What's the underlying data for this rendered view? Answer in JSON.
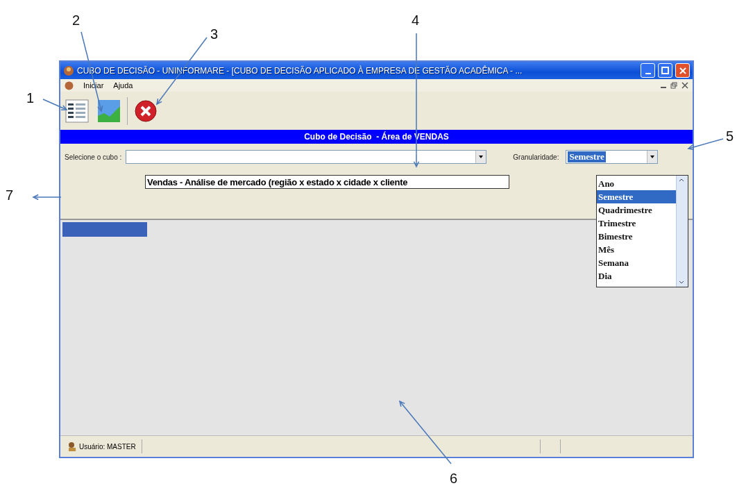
{
  "window": {
    "title": "CUBO DE DECISÃO - UNINFORMARE - [CUBO DE DECISÃO APLICADO À EMPRESA DE GESTÃO ACADÊMICA - ..."
  },
  "menu": [
    {
      "label": "Iniciar"
    },
    {
      "label": "Ajuda"
    }
  ],
  "banner": "Cubo de Decisão  - Área de VENDAS",
  "cube_select": {
    "label": "Selecione o cubo :",
    "open_item": "Vendas - Análise de mercado (região x estado x cidade x cliente"
  },
  "granularity": {
    "label": "Granularidade:",
    "value": "Semestre",
    "options": [
      {
        "label": "Ano",
        "selected": false
      },
      {
        "label": "Semestre",
        "selected": true
      },
      {
        "label": "Quadrimestre",
        "selected": false
      },
      {
        "label": "Trimestre",
        "selected": false
      },
      {
        "label": "Bimestre",
        "selected": false
      },
      {
        "label": "Mês",
        "selected": false
      },
      {
        "label": "Semana",
        "selected": false
      },
      {
        "label": "Dia",
        "selected": false
      }
    ]
  },
  "status_bar": {
    "user": "Usuário: MASTER"
  },
  "annotations": [
    {
      "number": "1"
    },
    {
      "number": "2"
    },
    {
      "number": "3"
    },
    {
      "number": "4"
    },
    {
      "number": "5"
    },
    {
      "number": "6"
    },
    {
      "number": "7"
    }
  ]
}
